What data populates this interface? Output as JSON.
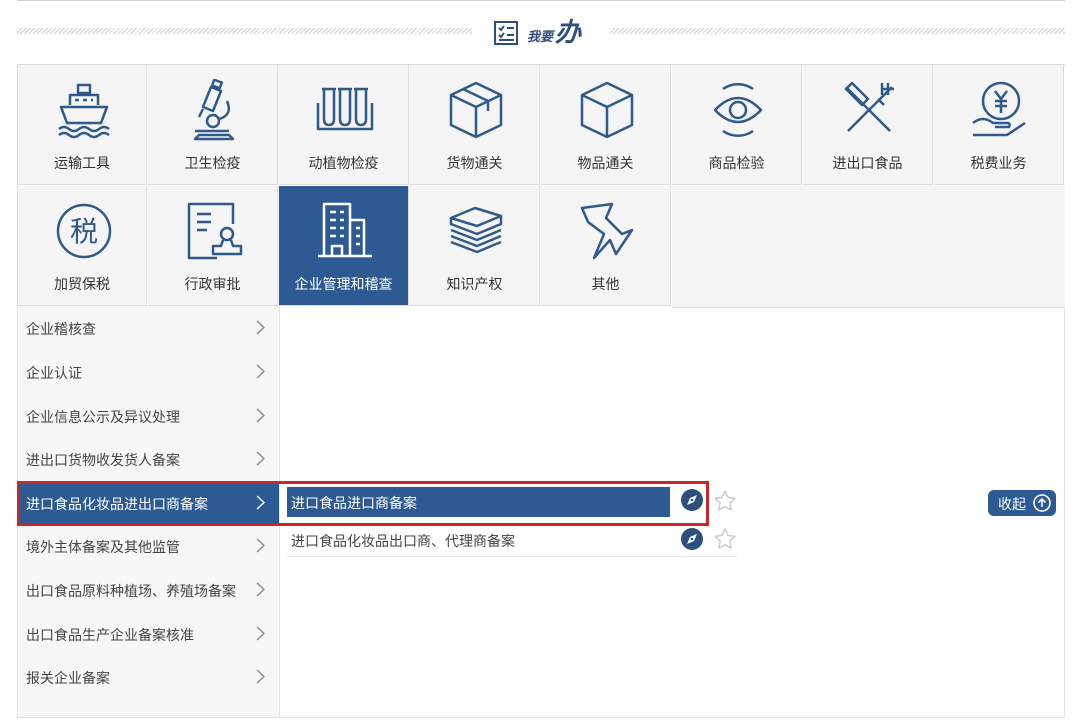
{
  "header": {
    "title_small": "我要",
    "title_big": "办"
  },
  "categories": [
    {
      "label": "运输工具",
      "icon": "ship-icon"
    },
    {
      "label": "卫生检疫",
      "icon": "microscope-icon"
    },
    {
      "label": "动植物检疫",
      "icon": "test-tubes-icon"
    },
    {
      "label": "货物通关",
      "icon": "package-box-icon"
    },
    {
      "label": "物品通关",
      "icon": "cube-icon"
    },
    {
      "label": "商品检验",
      "icon": "eye-inspection-icon"
    },
    {
      "label": "进出口食品",
      "icon": "fork-knife-icon"
    },
    {
      "label": "税费业务",
      "icon": "yen-coin-hand-icon"
    },
    {
      "label": "加贸保税",
      "icon": "tax-circle-icon"
    },
    {
      "label": "行政审批",
      "icon": "approval-stamp-icon"
    },
    {
      "label": "企业管理和稽查",
      "icon": "building-icon"
    },
    {
      "label": "知识产权",
      "icon": "books-stack-icon"
    },
    {
      "label": "其他",
      "icon": "pushpin-icon"
    }
  ],
  "active_category": "企业管理和稽查",
  "menu": [
    {
      "label": "企业稽核查"
    },
    {
      "label": "企业认证"
    },
    {
      "label": "企业信息公示及异议处理"
    },
    {
      "label": "进出口货物收发货人备案"
    },
    {
      "label": "进口食品化妆品进出口商备案"
    },
    {
      "label": "境外主体备案及其他监管"
    },
    {
      "label": "出口食品原料种植场、养殖场备案"
    },
    {
      "label": "出口食品生产企业备案核准"
    },
    {
      "label": "报关企业备案"
    }
  ],
  "active_menu": "进口食品化妆品进出口商备案",
  "submenu": [
    {
      "label": "进口食品进口商备案"
    },
    {
      "label": "进口食品化妆品出口商、代理商备案"
    }
  ],
  "collapse_label": "收起",
  "colors": {
    "accent": "#2d5a92",
    "highlight_border": "#c8262b",
    "icon_stroke": "#2f5a8a"
  }
}
